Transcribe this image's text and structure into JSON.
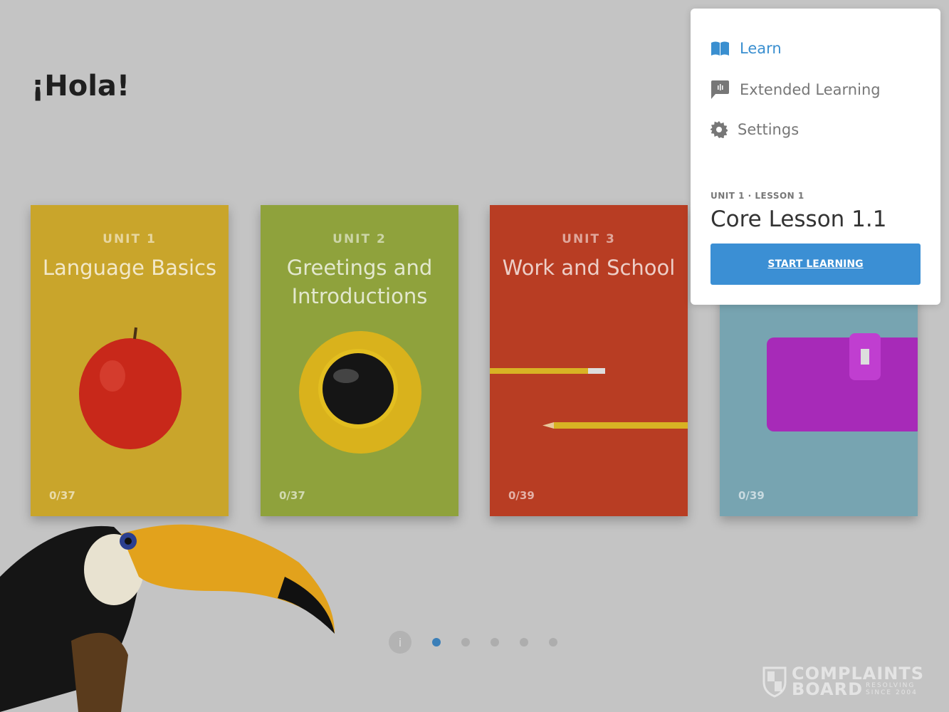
{
  "greeting": "¡Hola!",
  "units": [
    {
      "unit": "UNIT 1",
      "title": "Language Basics",
      "count": "0/37",
      "color": "#c9a52b"
    },
    {
      "unit": "UNIT 2",
      "title": "Greetings and Introductions",
      "count": "0/37",
      "color": "#8fa23c"
    },
    {
      "unit": "UNIT 3",
      "title": "Work and School",
      "count": "0/39",
      "color": "#b83d23"
    },
    {
      "unit": "",
      "title": "",
      "count": "0/39",
      "color": "#77a4b1"
    }
  ],
  "menu": {
    "items": [
      {
        "label": "Learn",
        "icon": "book-icon"
      },
      {
        "label": "Extended Learning",
        "icon": "chat-bubble-icon"
      },
      {
        "label": "Settings",
        "icon": "gear-icon"
      }
    ],
    "unit_lesson": "UNIT 1 · LESSON 1",
    "lesson_title": "Core Lesson 1.1",
    "start_button": "START LEARNING"
  },
  "pagination": {
    "info": "i",
    "pages": 5,
    "current": 1
  },
  "watermark": {
    "line1": "COMPLAINTS",
    "line2": "BOARD",
    "tag1": "RESOLVING",
    "tag2": "SINCE 2004"
  }
}
